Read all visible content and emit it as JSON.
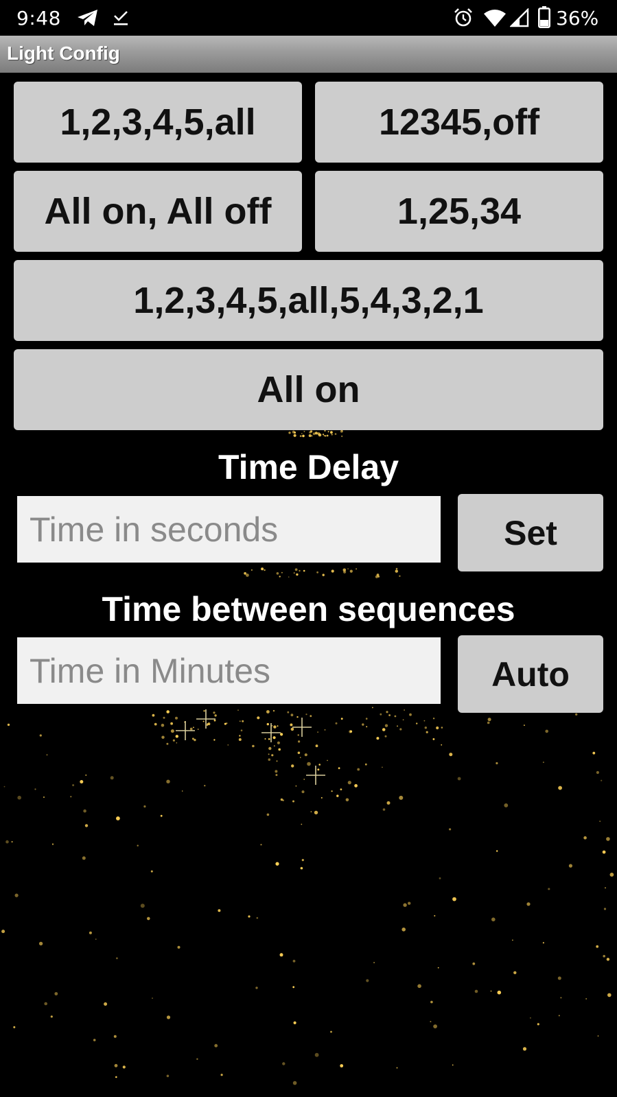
{
  "status_bar": {
    "time": "9:48",
    "battery_percent": "36%",
    "icons": [
      "telegram-icon",
      "download-done-icon",
      "alarm-icon",
      "wifi-icon",
      "signal-icon",
      "battery-icon"
    ]
  },
  "app": {
    "title": "Light Config"
  },
  "sequence_buttons": {
    "b1": "1,2,3,4,5,all",
    "b2": "12345,off",
    "b3": "All on, All off",
    "b4": "1,25,34",
    "b5": "1,2,3,4,5,all,5,4,3,2,1",
    "b6": "All on"
  },
  "time_delay": {
    "label": "Time Delay",
    "placeholder": "Time in seconds",
    "value": "",
    "button": "Set"
  },
  "time_between": {
    "label": "Time between sequences",
    "placeholder": "Time in Minutes",
    "value": "",
    "button": "Auto"
  },
  "colors": {
    "background": "#000000",
    "button_bg": "#cdcdcd",
    "input_bg": "#f1f1f1",
    "sparkle": "#ffd257"
  }
}
